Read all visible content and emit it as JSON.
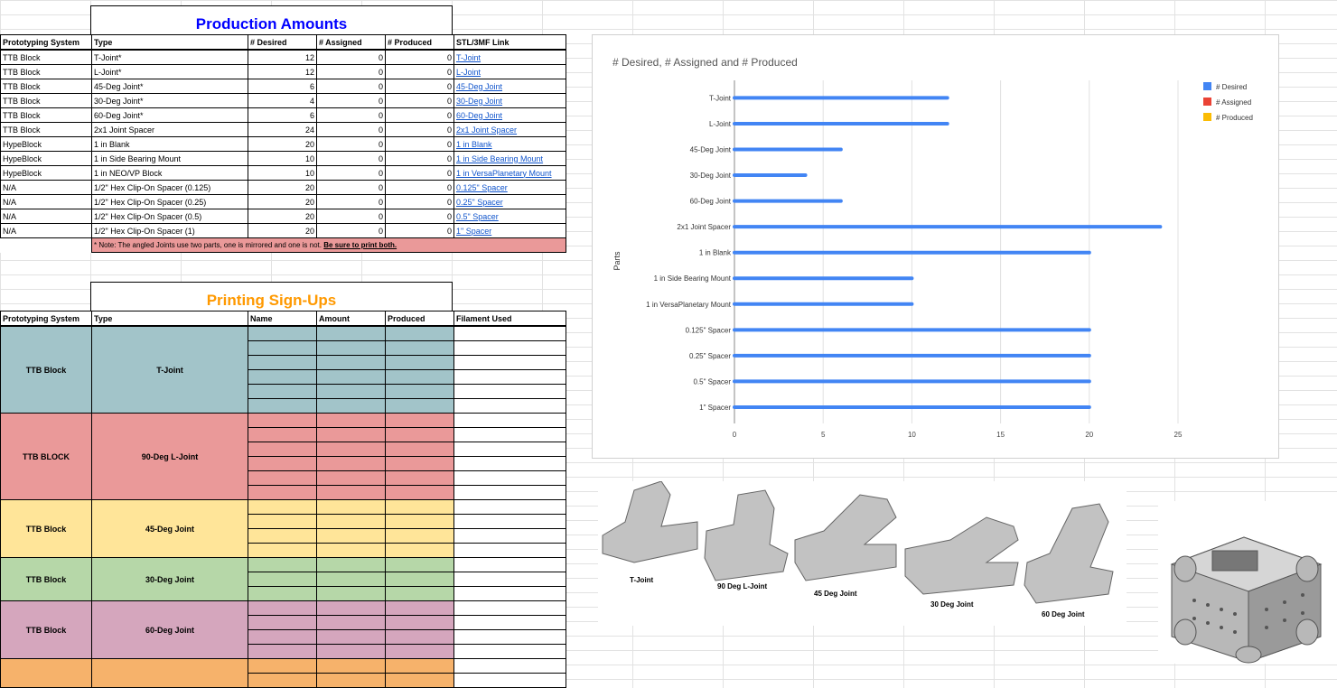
{
  "production": {
    "title": "Production Amounts",
    "headers": [
      "Prototyping System",
      "Type",
      "# Desired",
      "# Assigned",
      "# Produced",
      "STL/3MF Link"
    ],
    "rows": [
      {
        "system": "TTB Block",
        "type": "T-Joint*",
        "desired": "12",
        "assigned": "0",
        "produced": "0",
        "link": "T-Joint"
      },
      {
        "system": "TTB Block",
        "type": "L-Joint*",
        "desired": "12",
        "assigned": "0",
        "produced": "0",
        "link": "L-Joint"
      },
      {
        "system": "TTB Block",
        "type": "45-Deg Joint*",
        "desired": "6",
        "assigned": "0",
        "produced": "0",
        "link": "45-Deg Joint"
      },
      {
        "system": "TTB Block",
        "type": "30-Deg Joint*",
        "desired": "4",
        "assigned": "0",
        "produced": "0",
        "link": "30-Deg Joint"
      },
      {
        "system": "TTB Block",
        "type": "60-Deg Joint*",
        "desired": "6",
        "assigned": "0",
        "produced": "0",
        "link": "60-Deg Joint"
      },
      {
        "system": "TTB Block",
        "type": "2x1 Joint Spacer",
        "desired": "24",
        "assigned": "0",
        "produced": "0",
        "link": "2x1 Joint Spacer"
      },
      {
        "system": "HypeBlock",
        "type": "1 in Blank",
        "desired": "20",
        "assigned": "0",
        "produced": "0",
        "link": "1 in Blank"
      },
      {
        "system": "HypeBlock",
        "type": "1 in Side Bearing Mount",
        "desired": "10",
        "assigned": "0",
        "produced": "0",
        "link": "1 in Side Bearing Mount"
      },
      {
        "system": "HypeBlock",
        "type": "1 in NEO/VP Block",
        "desired": "10",
        "assigned": "0",
        "produced": "0",
        "link": "1 in VersaPlanetary Mount"
      },
      {
        "system": "N/A",
        "type": "1/2\" Hex Clip-On Spacer (0.125)",
        "desired": "20",
        "assigned": "0",
        "produced": "0",
        "link": "0.125\" Spacer"
      },
      {
        "system": "N/A",
        "type": "1/2\" Hex Clip-On Spacer (0.25)",
        "desired": "20",
        "assigned": "0",
        "produced": "0",
        "link": "0.25\" Spacer"
      },
      {
        "system": "N/A",
        "type": "1/2\" Hex Clip-On Spacer (0.5)",
        "desired": "20",
        "assigned": "0",
        "produced": "0",
        "link": "0.5\" Spacer"
      },
      {
        "system": "N/A",
        "type": "1/2\" Hex Clip-On Spacer (1)",
        "desired": "20",
        "assigned": "0",
        "produced": "0",
        "link": "1\" Spacer"
      }
    ],
    "note": "* Note: The angled Joints use two parts, one is mirrored and one is not. ",
    "note_bold": "Be sure to print both.",
    "title_color": "#0000ff",
    "note_bg": "#ea9999"
  },
  "signups": {
    "title": "Printing Sign-Ups",
    "title_color": "#ff9900",
    "headers": [
      "Prototyping System",
      "Type",
      "Name",
      "Amount",
      "Produced",
      "Filament Used"
    ],
    "groups": [
      {
        "system": "TTB Block",
        "type": "T-Joint",
        "color": "#a2c4c9"
      },
      {
        "system": "TTB BLOCK",
        "type": "90-Deg L-Joint",
        "color": "#ea9999"
      },
      {
        "system": "TTB Block",
        "type": "45-Deg Joint",
        "color": "#ffe599"
      },
      {
        "system": "TTB Block",
        "type": "30-Deg Joint",
        "color": "#b6d7a8"
      },
      {
        "system": "TTB Block",
        "type": "60-Deg Joint",
        "color": "#d5a6bd"
      },
      {
        "color": "#f6b26b"
      }
    ]
  },
  "chart_data": {
    "type": "bar",
    "title": "# Desired, # Assigned and # Produced",
    "ylabel": "Parts",
    "categories": [
      "T-Joint",
      "L-Joint",
      "45-Deg Joint",
      "30-Deg Joint",
      "60-Deg Joint",
      "2x1 Joint Spacer",
      "1 in Blank",
      "1 in Side Bearing Mount",
      "1 in VersaPlanetary Mount",
      "0.125\" Spacer",
      "0.25\" Spacer",
      "0.5\" Spacer",
      "1\" Spacer"
    ],
    "series": [
      {
        "name": "# Desired",
        "color": "#4285f4",
        "values": [
          12,
          12,
          6,
          4,
          6,
          24,
          20,
          10,
          10,
          20,
          20,
          20,
          20
        ]
      },
      {
        "name": "# Assigned",
        "color": "#ea4335",
        "values": [
          0,
          0,
          0,
          0,
          0,
          0,
          0,
          0,
          0,
          0,
          0,
          0,
          0
        ]
      },
      {
        "name": "# Produced",
        "color": "#fbbc04",
        "values": [
          0,
          0,
          0,
          0,
          0,
          0,
          0,
          0,
          0,
          0,
          0,
          0,
          0
        ]
      }
    ],
    "xticks": [
      "0",
      "5",
      "10",
      "15",
      "20",
      "25"
    ],
    "xlim": [
      0,
      25
    ],
    "grid": true,
    "legend": "top-right"
  },
  "images": {
    "captions": [
      "T-Joint",
      "90 Deg L-Joint",
      "45 Deg Joint",
      "30 Deg Joint",
      "60 Deg Joint"
    ]
  }
}
